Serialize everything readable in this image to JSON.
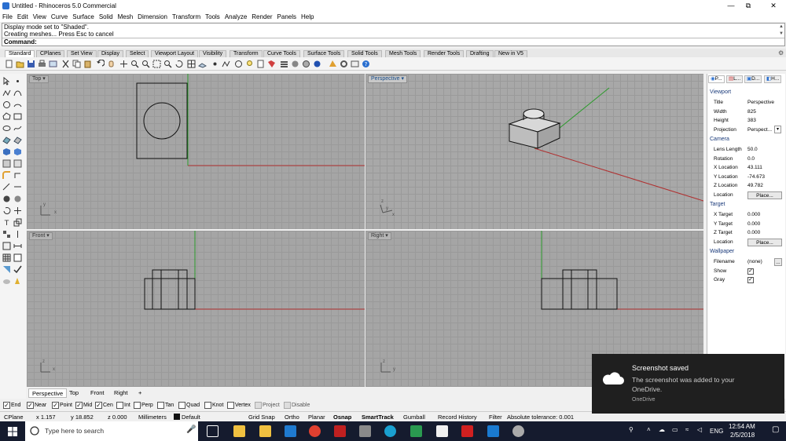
{
  "window": {
    "title": "Untitled - Rhinoceros 5.0 Commercial",
    "minimize_glyph": "—",
    "maximize_glyph": "⧉",
    "close_glyph": "✕"
  },
  "menu": [
    "File",
    "Edit",
    "View",
    "Curve",
    "Surface",
    "Solid",
    "Mesh",
    "Dimension",
    "Transform",
    "Tools",
    "Analyze",
    "Render",
    "Panels",
    "Help"
  ],
  "command_history": [
    "Display mode set to \"Shaded\".",
    "Creating meshes... Press Esc to cancel"
  ],
  "command_prompt": "Command:",
  "toolbar_tabs": [
    "Standard",
    "CPlanes",
    "Set View",
    "Display",
    "Select",
    "Viewport Layout",
    "Visibility",
    "Transform",
    "Curve Tools",
    "Surface Tools",
    "Solid Tools",
    "Mesh Tools",
    "Render Tools",
    "Drafting",
    "New in V5"
  ],
  "viewports": {
    "top": "Top",
    "perspective": "Perspective",
    "front": "Front",
    "right": "Right"
  },
  "axis_labels": {
    "x": "x",
    "y": "y",
    "z": "z"
  },
  "viewport_tabs": [
    "Perspective",
    "Top",
    "Front",
    "Right",
    "+"
  ],
  "osnaps": [
    {
      "label": "End",
      "checked": true
    },
    {
      "label": "Near",
      "checked": true
    },
    {
      "label": "Point",
      "checked": true
    },
    {
      "label": "Mid",
      "checked": true
    },
    {
      "label": "Cen",
      "checked": true
    },
    {
      "label": "Int",
      "checked": false
    },
    {
      "label": "Perp",
      "checked": false
    },
    {
      "label": "Tan",
      "checked": false
    },
    {
      "label": "Quad",
      "checked": false
    },
    {
      "label": "Knot",
      "checked": false
    },
    {
      "label": "Vertex",
      "checked": false
    },
    {
      "label": "Project",
      "checked": false
    },
    {
      "label": "Disable",
      "checked": false
    }
  ],
  "status": {
    "cplane": "CPlane",
    "x": "x 1.157",
    "y": "y 18.852",
    "z": "z 0.000",
    "units": "Millimeters",
    "layer": "Default",
    "grid_snap": "Grid Snap",
    "ortho": "Ortho",
    "planar": "Planar",
    "osnap": "Osnap",
    "smarttrack": "SmartTrack",
    "gumball": "Gumball",
    "record_history": "Record History",
    "filter": "Filter",
    "tolerance": "Absolute tolerance: 0.001"
  },
  "panel": {
    "tabs": [
      "P...",
      "L...",
      "D...",
      "H..."
    ],
    "viewport_section": "Viewport",
    "title_label": "Title",
    "title_value": "Perspective",
    "width_label": "Width",
    "width_value": "825",
    "height_label": "Height",
    "height_value": "383",
    "projection_label": "Projection",
    "projection_value": "Perspect...",
    "camera_section": "Camera",
    "lens_label": "Lens Length",
    "lens_value": "50.0",
    "rotation_label": "Rotation",
    "rotation_value": "0.0",
    "xloc_label": "X Location",
    "xloc_value": "43.111",
    "yloc_label": "Y Location",
    "yloc_value": "-74.673",
    "zloc_label": "Z Location",
    "zloc_value": "49.782",
    "location_label": "Location",
    "place_button": "Place...",
    "target_section": "Target",
    "xt_label": "X Target",
    "xt_value": "0.000",
    "yt_label": "Y Target",
    "yt_value": "0.000",
    "zt_label": "Z Target",
    "zt_value": "0.000",
    "tlocation_label": "Location",
    "tplace_button": "Place...",
    "wallpaper_section": "Wallpaper",
    "filename_label": "Filename",
    "filename_value": "(none)",
    "browse_button": "...",
    "show_label": "Show",
    "gray_label": "Gray"
  },
  "toast": {
    "title": "Screenshot saved",
    "body": "The screenshot was added to your OneDrive.",
    "source": "OneDrive"
  },
  "taskbar": {
    "search_placeholder": "Type here to search",
    "language": "ENG",
    "time": "12:54 AM",
    "date": "2/5/2018"
  },
  "colors": {
    "viewport_bg": "#a5a5a5",
    "x_axis": "#b03030",
    "y_axis": "#2a9a2a",
    "taskbar": "#151b2e",
    "toast": "#1f1f1f"
  }
}
